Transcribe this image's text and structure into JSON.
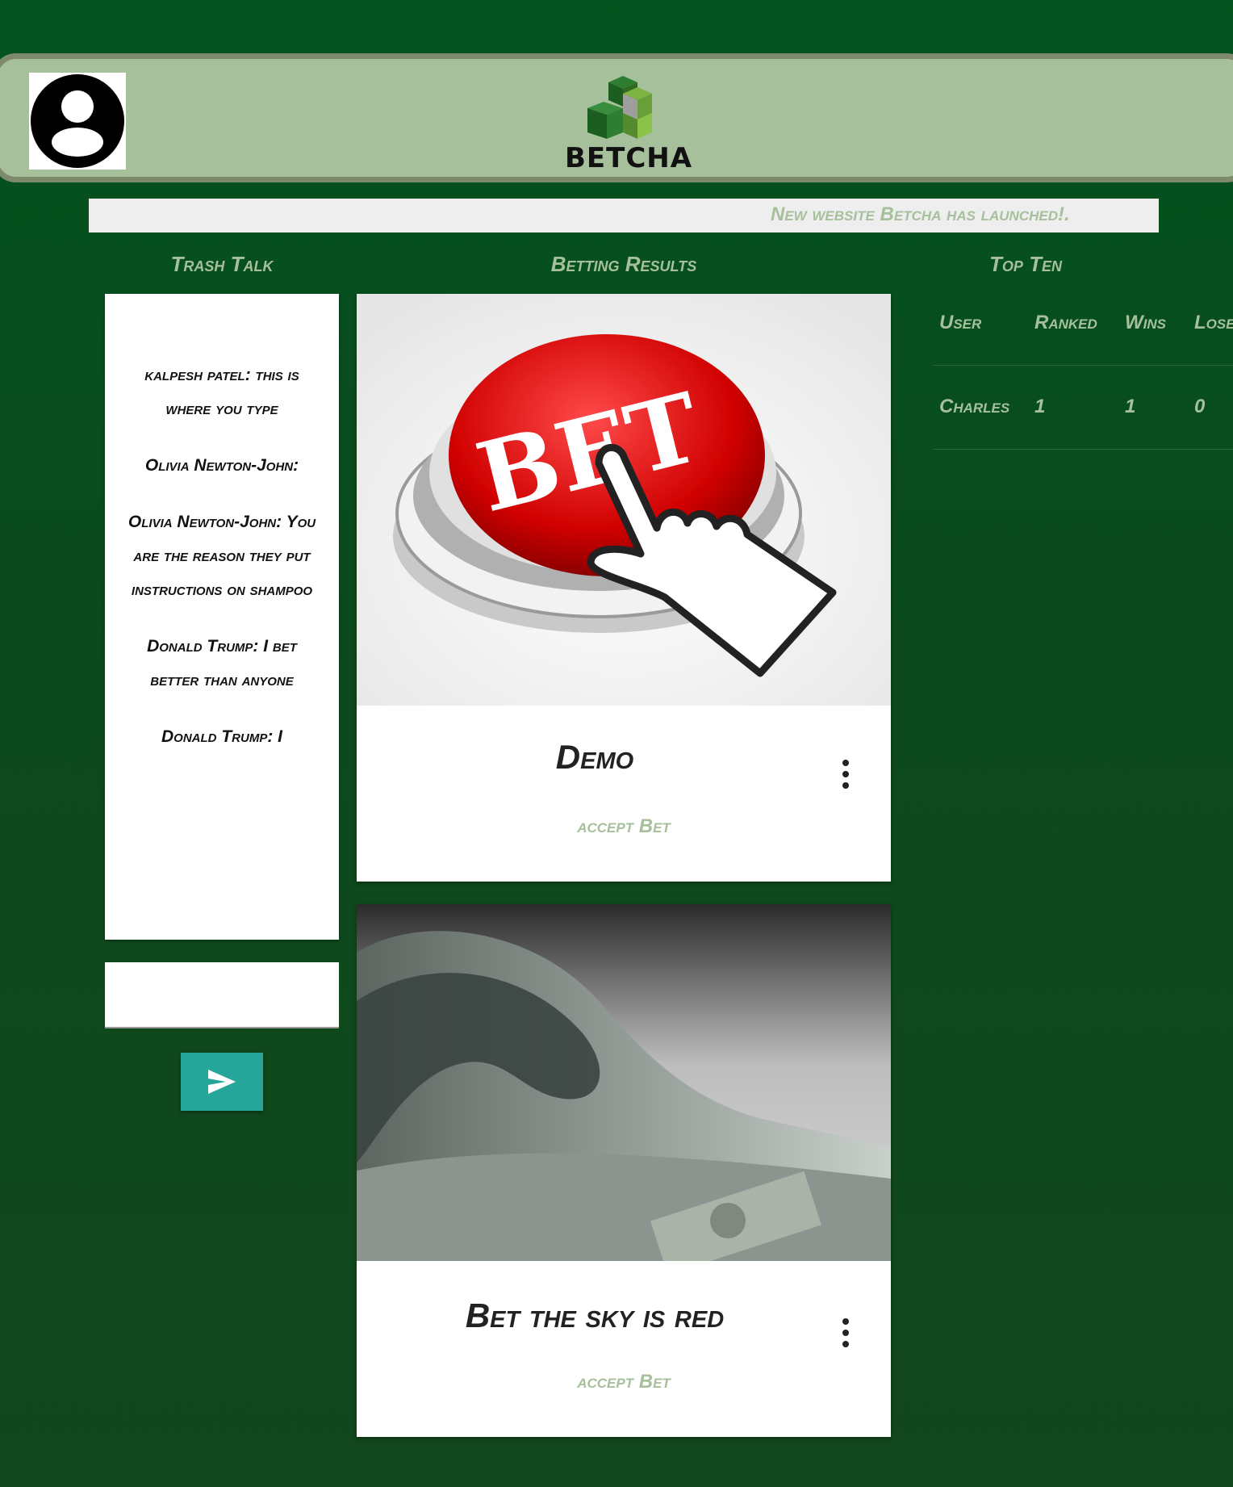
{
  "header": {
    "avatar_icon": "account-circle-icon",
    "logo_icon": "green-cubes-logo-icon",
    "logo_text": "BETCHA"
  },
  "ticker": {
    "text": "New website Betcha has launched!."
  },
  "sections": {
    "trash_talk": "Trash Talk",
    "betting_results": "Betting Results",
    "top_ten": "Top Ten"
  },
  "chat": {
    "messages": [
      "kalpesh patel: this is where you type",
      "Olivia Newton-John:",
      "Olivia Newton-John: You are the reason they put instructions on shampoo",
      "Donald Trump: I bet better than anyone",
      "Donald Trump: I"
    ],
    "input_value": "",
    "send_icon": "send-arrow-icon"
  },
  "bets": [
    {
      "title": "Demo",
      "action": "accept Bet",
      "image": "red-bet-button-with-pointer-hand",
      "menu_icon": "more-vert-icon"
    },
    {
      "title": "Bet the sky is red",
      "action": "accept Bet",
      "image": "wave-of-money-photo",
      "menu_icon": "more-vert-icon"
    }
  ],
  "top_ten": {
    "columns": [
      "User",
      "Ranked",
      "Wins",
      "Lose"
    ],
    "rows": [
      {
        "user": "Charles",
        "ranked": "1",
        "wins": "1",
        "lose": "0"
      }
    ]
  },
  "colors": {
    "background": "#03531f",
    "header": "#a6c09b",
    "accent_text": "#a6c09b",
    "send_button": "#26a69a"
  }
}
